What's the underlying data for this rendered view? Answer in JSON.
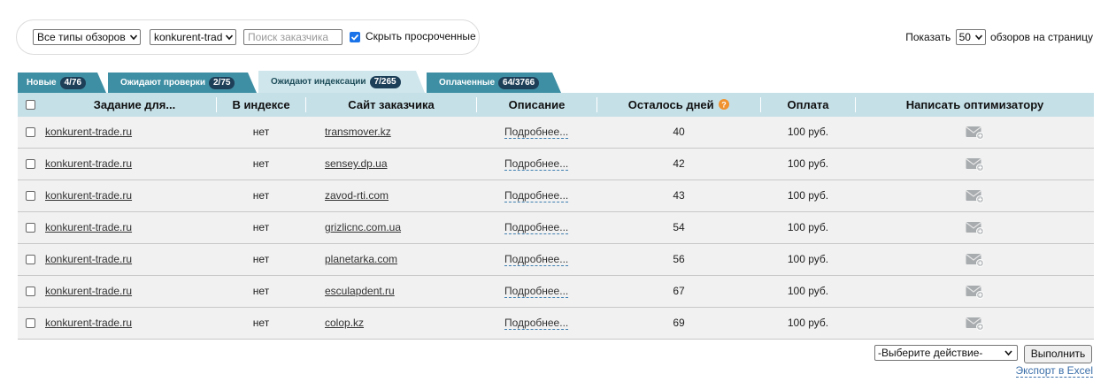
{
  "filters": {
    "review_type": "Все типы обзоров",
    "site": "konkurent-trad",
    "search_placeholder": "Поиск заказчика",
    "hide_expired_label": "Скрыть просроченные",
    "hide_expired_checked": true
  },
  "per_page": {
    "prefix": "Показать",
    "value": "50",
    "suffix": "обзоров на страницу"
  },
  "tabs": [
    {
      "label": "Новые",
      "badge": "4/76",
      "active": false
    },
    {
      "label": "Ожидают проверки",
      "badge": "2/75",
      "active": false
    },
    {
      "label": "Ожидают индексации",
      "badge": "7/265",
      "active": true
    },
    {
      "label": "Оплаченные",
      "badge": "64/3766",
      "active": false
    }
  ],
  "columns": {
    "task": "Задание для...",
    "indexed": "В индексе",
    "customer_site": "Сайт заказчика",
    "description": "Описание",
    "days_left": "Осталось дней",
    "payment": "Оплата",
    "write": "Написать оптимизатору"
  },
  "rows": [
    {
      "task": "konkurent-trade.ru",
      "indexed": "нет",
      "site": "transmover.kz",
      "desc": "Подробнее...",
      "days": "40",
      "pay": "100 руб."
    },
    {
      "task": "konkurent-trade.ru",
      "indexed": "нет",
      "site": "sensey.dp.ua",
      "desc": "Подробнее...",
      "days": "42",
      "pay": "100 руб."
    },
    {
      "task": "konkurent-trade.ru",
      "indexed": "нет",
      "site": "zavod-rti.com",
      "desc": "Подробнее...",
      "days": "43",
      "pay": "100 руб."
    },
    {
      "task": "konkurent-trade.ru",
      "indexed": "нет",
      "site": "grizlicnc.com.ua",
      "desc": "Подробнее...",
      "days": "54",
      "pay": "100 руб."
    },
    {
      "task": "konkurent-trade.ru",
      "indexed": "нет",
      "site": "planetarka.com",
      "desc": "Подробнее...",
      "days": "56",
      "pay": "100 руб."
    },
    {
      "task": "konkurent-trade.ru",
      "indexed": "нет",
      "site": "esculapdent.ru",
      "desc": "Подробнее...",
      "days": "67",
      "pay": "100 руб."
    },
    {
      "task": "konkurent-trade.ru",
      "indexed": "нет",
      "site": "colop.kz",
      "desc": "Подробнее...",
      "days": "69",
      "pay": "100 руб."
    }
  ],
  "actions": {
    "select_value": "-Выберите действие-",
    "run_label": "Выполнить",
    "export_label": "Экспорт в Excel"
  },
  "colors": {
    "tab_bg": "#3f8fa4",
    "tab_active_bg": "#cfe6ec",
    "badge_bg": "#1e3f58",
    "header_bg": "#c6e0e8",
    "row_bg": "#f1f1f1",
    "help_icon": "#f0922e"
  }
}
